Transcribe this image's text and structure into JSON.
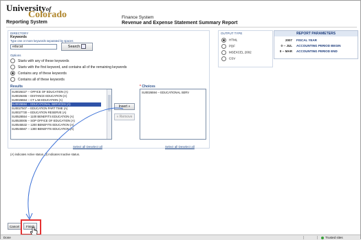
{
  "header": {
    "university_word": "University",
    "of_word": "of",
    "colorado_word": "Colorado",
    "reporting_system": "Reporting System",
    "system_name": "Finance System",
    "report_name": "Revenue and Expense Statement Summary Report"
  },
  "directory": {
    "section_label": "DIRECTORY",
    "keywords_label": "Keywords",
    "keywords_hint": "Type one or more keywords separated by spaces",
    "keywords_value": "educat",
    "search_label": "Search",
    "options_label": "Options",
    "options": [
      {
        "label": "Starts with any of these keywords",
        "selected": false
      },
      {
        "label": "Starts with the first keyword, and contains all of the remaining keywords",
        "selected": false
      },
      {
        "label": "Contains any of these keywords",
        "selected": true
      },
      {
        "label": "Contains all of these keywords",
        "selected": false
      }
    ],
    "results_label": "Results",
    "results": [
      {
        "text": "SU0026427 -- OFFICE OF EDUCATION (A)",
        "selected": false
      },
      {
        "text": "SU0026465 -- DISTANCE EDUCATION (A)",
        "selected": false
      },
      {
        "text": "SU0026554 -- CT LAB EDUCATION (A)",
        "selected": false
      },
      {
        "text": "SU0026594 -- EDUCATIONAL SERVICES (A)",
        "selected": true
      },
      {
        "text": "SU0027507 -- EDUCATION PART TIME (A)",
        "selected": false
      },
      {
        "text": "SU0027730 -- EDUCATION RESERVE (A)",
        "selected": false
      },
      {
        "text": "SU0528554 -- 1100 BENEFITS EDUCATION (A)",
        "selected": false
      },
      {
        "text": "SU0530005 -- SOP OFFICE OF EDUCATION (A)",
        "selected": false
      },
      {
        "text": "SU0545532 -- 1200 BENEFITS EDUCATION (A)",
        "selected": false
      },
      {
        "text": "SU0545567 -- 1300 BENEFITS EDUCATION (A)",
        "selected": false
      }
    ],
    "choices_label": "Choices",
    "choices": [
      "SU0026594 -- EDUCATIONAL SERV"
    ],
    "insert_label": "Insert »",
    "remove_label": "« Remove",
    "select_all_left": "Select all",
    "deselect_all_left": "Deselect all",
    "select_all_right": "Select all",
    "deselect_all_right": "Deselect all",
    "status_note": "(A) indicates Active status. (I) indicates Inactive status."
  },
  "output": {
    "section_label": "OUTPUT TYPE",
    "options": [
      {
        "label": "HTML",
        "selected": true
      },
      {
        "label": "PDF",
        "selected": false
      },
      {
        "label": "MSEXCEL 2002",
        "selected": false
      },
      {
        "label": "CSV",
        "selected": false
      }
    ]
  },
  "parameters": {
    "title": "REPORT PARAMETERS",
    "rows": [
      {
        "value": "2007",
        "label": "FISCAL YEAR"
      },
      {
        "value": "0 -- JUL",
        "label": "ACCOUNTING PERIOD BEGIN"
      },
      {
        "value": "0 -- MAR",
        "label": "ACCOUNTING PERIOD END"
      }
    ]
  },
  "footer": {
    "cancel_label": "Cancel",
    "finish_label": "Finish"
  },
  "statusbar": {
    "left_text": "Done",
    "zone_text": "Trusted sites"
  },
  "colors": {
    "highlight": "#e43030",
    "arrow": "#3a6fd6",
    "selection": "#2f53a8"
  }
}
